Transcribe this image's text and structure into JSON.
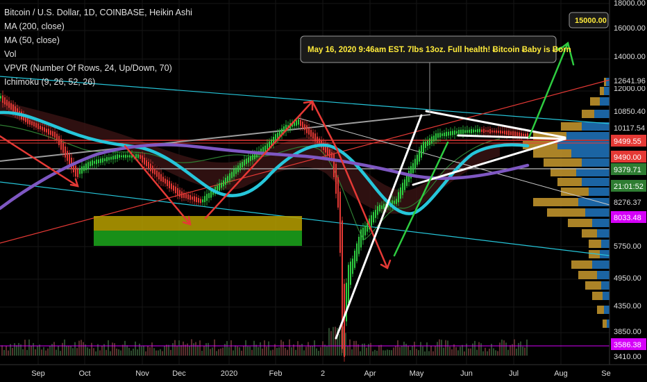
{
  "legend": {
    "symbol": "Bitcoin / U.S. Dollar, 1D, COINBASE, Heikin Ashi",
    "ma200": "MA (200, close)",
    "ma50": "MA (50, close)",
    "vol": "Vol",
    "vpvr": "VPVR (Number Of Rows, 24, Up/Down, 70)",
    "ichimoku": "Ichimoku (9, 26, 52, 26)"
  },
  "annotation": {
    "note": "May 16, 2020 9:46am EST. 7lbs 13oz. Full health! Ƀitcoin Ƀaby is Ƀorn",
    "target": "15000.00"
  },
  "colors": {
    "background": "#000000",
    "ma50": "#26c6da",
    "ma200": "#7e57c2",
    "arrow_red": "#e53935",
    "arrow_green": "#2ecc40",
    "vpvr_up": "#1e6fb5",
    "vpvr_down": "#c99a2e",
    "volume": "#5a3a3a"
  },
  "chart_data": {
    "type": "line",
    "title": "Bitcoin / U.S. Dollar, 1D, COINBASE, Heikin Ashi",
    "scale": "log",
    "ylim": [
      3410,
      18000
    ],
    "x_ticks": [
      "Sep",
      "Oct",
      "Nov",
      "Dec",
      "2020",
      "Feb",
      "2",
      "Apr",
      "May",
      "Jun",
      "Jul",
      "Aug",
      "Se"
    ],
    "y_ticks": [
      "18000.00",
      "16000.00",
      "14000.00",
      "12000.00",
      "5750.00",
      "4950.00",
      "4350.00",
      "3850.00",
      "3410.00"
    ],
    "price_tags": [
      {
        "label": "12641.96",
        "value": 12641.96,
        "bg": "#000000",
        "fg": "#dddddd"
      },
      {
        "label": "10850.40",
        "value": 10850.4,
        "bg": "#000000",
        "fg": "#dddddd"
      },
      {
        "label": "10117.54",
        "value": 10117.54,
        "bg": "#000000",
        "fg": "#dddddd"
      },
      {
        "label": "9499.55",
        "value": 9499.55,
        "bg": "#e53935",
        "fg": "#ffffff"
      },
      {
        "label": "9490.00",
        "value": 9490.0,
        "bg": "#e53935",
        "fg": "#ffffff"
      },
      {
        "label": "9379.71",
        "value": 9379.71,
        "bg": "#2e7d32",
        "fg": "#ffffff"
      },
      {
        "label": "21:01:52",
        "value": 9000,
        "bg": "#2e7d32",
        "fg": "#ffffff"
      },
      {
        "label": "8276.37",
        "value": 8276.37,
        "bg": "#000000",
        "fg": "#dddddd"
      },
      {
        "label": "8033.48",
        "value": 8033.48,
        "bg": "#d500f9",
        "fg": "#ffffff"
      },
      {
        "label": "3586.38",
        "value": 3586.38,
        "bg": "#d500f9",
        "fg": "#ffffff"
      }
    ],
    "series": [
      {
        "name": "MA (50, close)",
        "values": [
          10500,
          10200,
          10000,
          9900,
          9800,
          9600,
          9300,
          8600,
          8100,
          7800,
          7400,
          7200,
          7300,
          8000,
          8800,
          9500,
          9700,
          9400,
          8600,
          7700,
          7300,
          7500,
          8600,
          9100,
          9300,
          9400,
          9450
        ]
      },
      {
        "name": "MA (200, close)",
        "values": [
          7200,
          7800,
          8400,
          8900,
          9200,
          9400,
          9500,
          9450,
          9300,
          9100,
          8900,
          8800,
          8700,
          8800,
          9000,
          9100,
          9150,
          9000,
          8800,
          8600,
          8500,
          8450,
          8500,
          8600,
          8700,
          8800,
          8900
        ]
      }
    ]
  }
}
